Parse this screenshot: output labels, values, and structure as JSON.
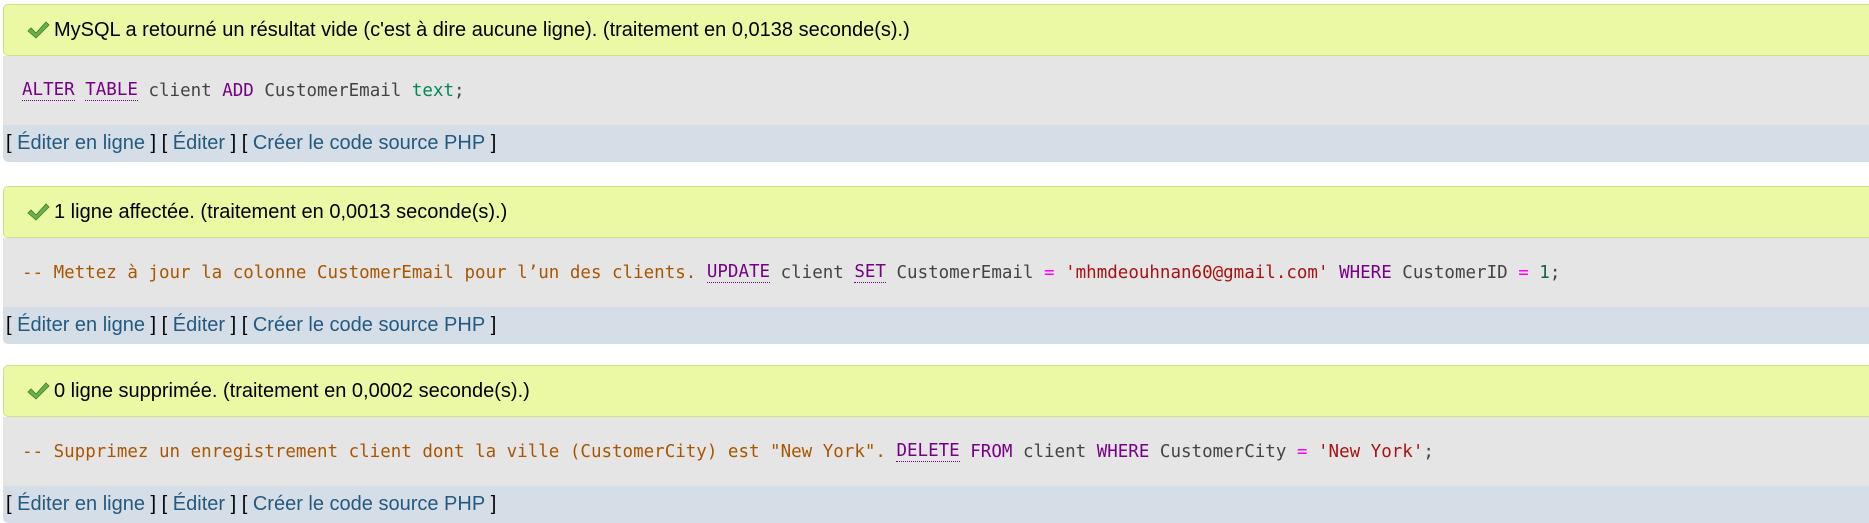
{
  "colors": {
    "success_bg": "#ebf8a4",
    "code_bg": "#e5e5e5",
    "links_bg": "#d5dde6",
    "link": "#235a81",
    "keyword": "#770088",
    "comment": "#aa5500",
    "string": "#aa1111",
    "operator": "#ff00ff",
    "number": "#116644",
    "type": "#008855"
  },
  "icons": {
    "success": "checkmark-icon"
  },
  "links": {
    "open1": "[ ",
    "edit_inline": "Éditer en ligne",
    "sep1": " ] [ ",
    "edit": "Éditer",
    "sep2": " ] [ ",
    "create_php": "Créer le code source PHP",
    "close": " ]"
  },
  "blocks": [
    {
      "message": "MySQL a retourné un résultat vide (c'est à dire aucune ligne). (traitement en 0,0138 seconde(s).)",
      "sql": {
        "t1": "ALTER",
        "t2": " ",
        "t3": "TABLE",
        "t4": " client ",
        "t5": "ADD",
        "t6": " CustomerEmail ",
        "t7": "text",
        "t8": ";"
      }
    },
    {
      "message": "1 ligne affectée. (traitement en 0,0013 seconde(s).)",
      "sql": {
        "comment": "-- Mettez à jour la colonne CustomerEmail pour l’un des clients. ",
        "t1": "UPDATE",
        "t2": " client ",
        "t3": "SET",
        "t4": " CustomerEmail ",
        "t5": "=",
        "t6": " ",
        "t7": "'mhmdeouhnan60@gmail.com'",
        "t8": " ",
        "t9": "WHERE",
        "t10": " CustomerID ",
        "t11": "=",
        "t12": " ",
        "t13": "1",
        "t14": ";"
      }
    },
    {
      "message": "0 ligne supprimée. (traitement en 0,0002 seconde(s).)",
      "sql": {
        "comment": "-- Supprimez un enregistrement client dont la ville (CustomerCity) est \"New York\". ",
        "t1": "DELETE",
        "t2": " ",
        "t3": "FROM",
        "t4": " client ",
        "t5": "WHERE",
        "t6": " CustomerCity ",
        "t7": "=",
        "t8": " ",
        "t9": "'New York'",
        "t10": ";"
      }
    }
  ]
}
